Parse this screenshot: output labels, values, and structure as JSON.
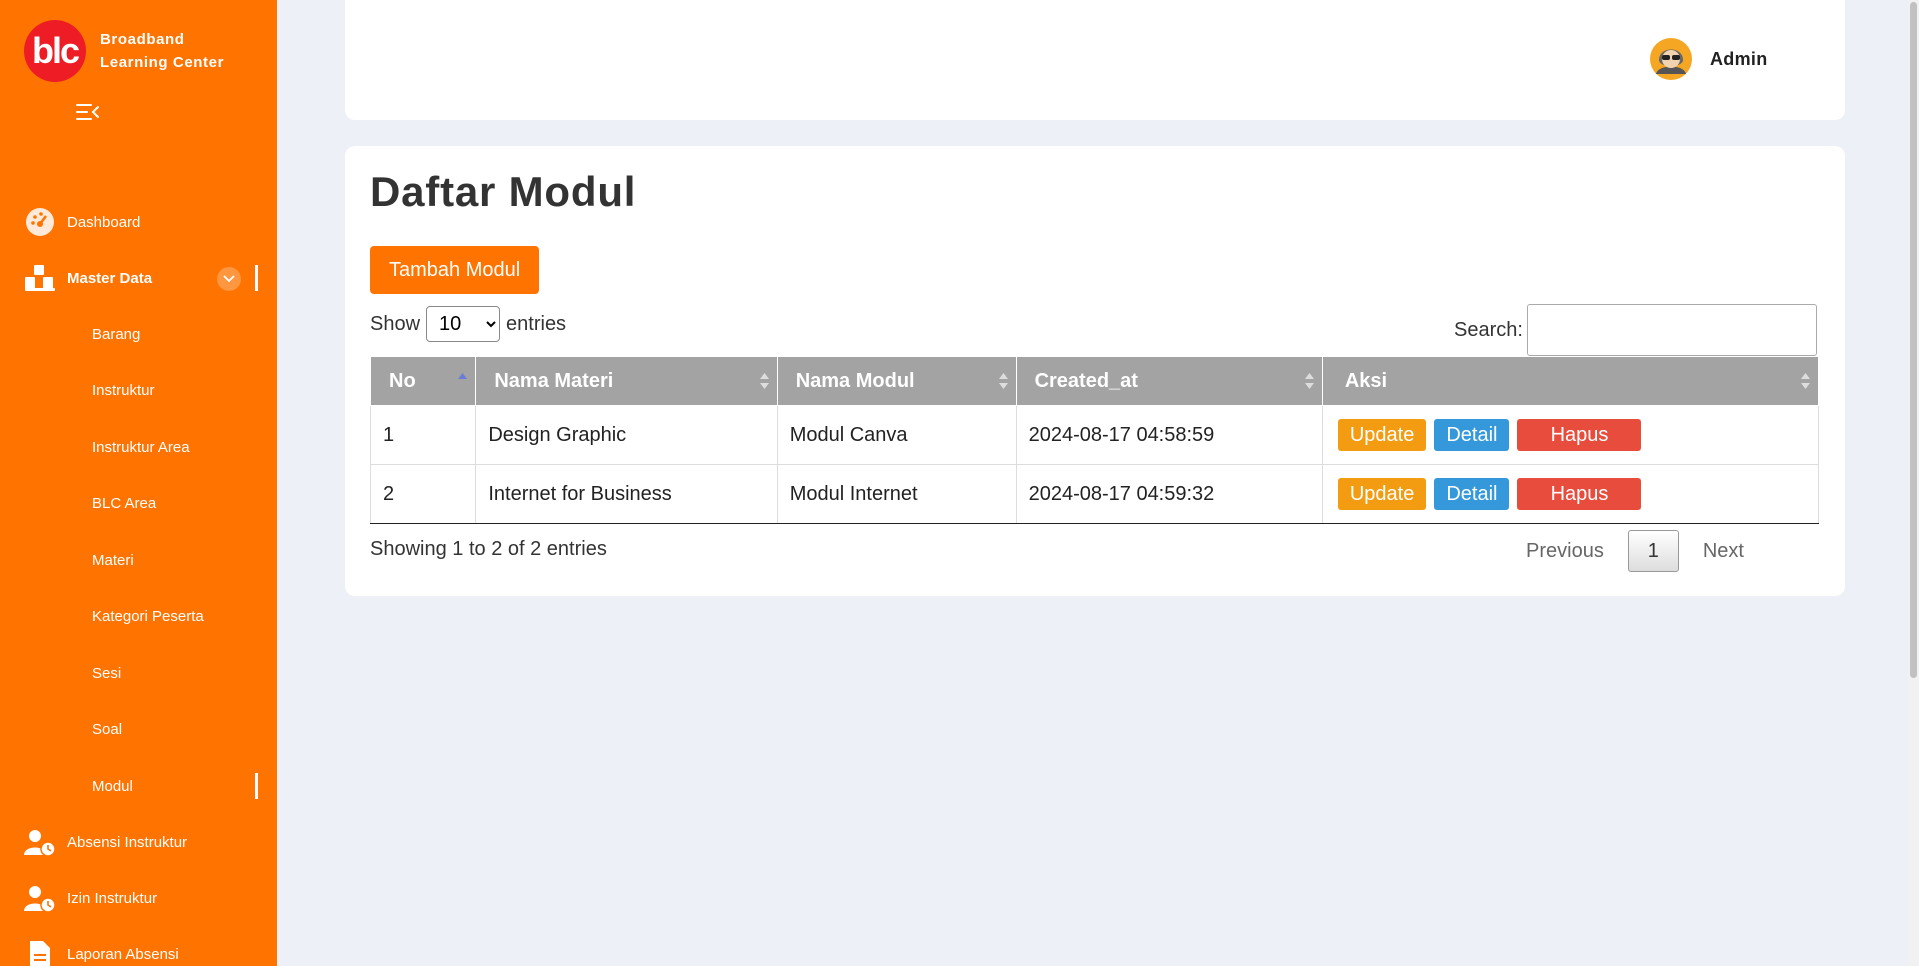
{
  "brand": {
    "logo_text": "blc",
    "line1": "Broadband",
    "line2": "Learning Center"
  },
  "sidebar": {
    "items": [
      {
        "label": "Dashboard",
        "icon": "dashboard-icon"
      },
      {
        "label": "Master Data",
        "icon": "boxes-icon",
        "expanded": true
      },
      {
        "label": "Absensi Instruktur",
        "icon": "user-clock-icon"
      },
      {
        "label": "Izin Instruktur",
        "icon": "user-clock-icon"
      },
      {
        "label": "Laporan Absensi",
        "icon": "document-icon"
      }
    ],
    "submenu": [
      "Barang",
      "Instruktur",
      "Instruktur Area",
      "BLC Area",
      "Materi",
      "Kategori Peserta",
      "Sesi",
      "Soal",
      "Modul"
    ],
    "active_submenu": "Modul"
  },
  "header": {
    "user_name": "Admin",
    "avatar_icon": "avatar-icon"
  },
  "main": {
    "title": "Daftar Modul",
    "add_button": "Tambah Modul",
    "length": {
      "show": "Show",
      "value": "10",
      "suffix": "entries"
    },
    "search_label": "Search:",
    "columns": [
      "No",
      "Nama Materi",
      "Nama Modul",
      "Created_at",
      "Aksi"
    ],
    "rows": [
      {
        "no": "1",
        "materi": "Design Graphic",
        "modul": "Modul Canva",
        "created_at": "2024-08-17 04:58:59"
      },
      {
        "no": "2",
        "materi": "Internet for Business",
        "modul": "Modul Internet",
        "created_at": "2024-08-17 04:59:32"
      }
    ],
    "actions": {
      "update": "Update",
      "detail": "Detail",
      "hapus": "Hapus"
    },
    "info": "Showing 1 to 2 of 2 entries",
    "pagination": {
      "previous": "Previous",
      "current": "1",
      "next": "Next"
    }
  },
  "colors": {
    "sidebar": "#ff7300",
    "logo": "#ee1c24",
    "table_header": "#a3a3a3",
    "update": "#f39c12",
    "detail": "#3498db",
    "hapus": "#e74c3c"
  }
}
